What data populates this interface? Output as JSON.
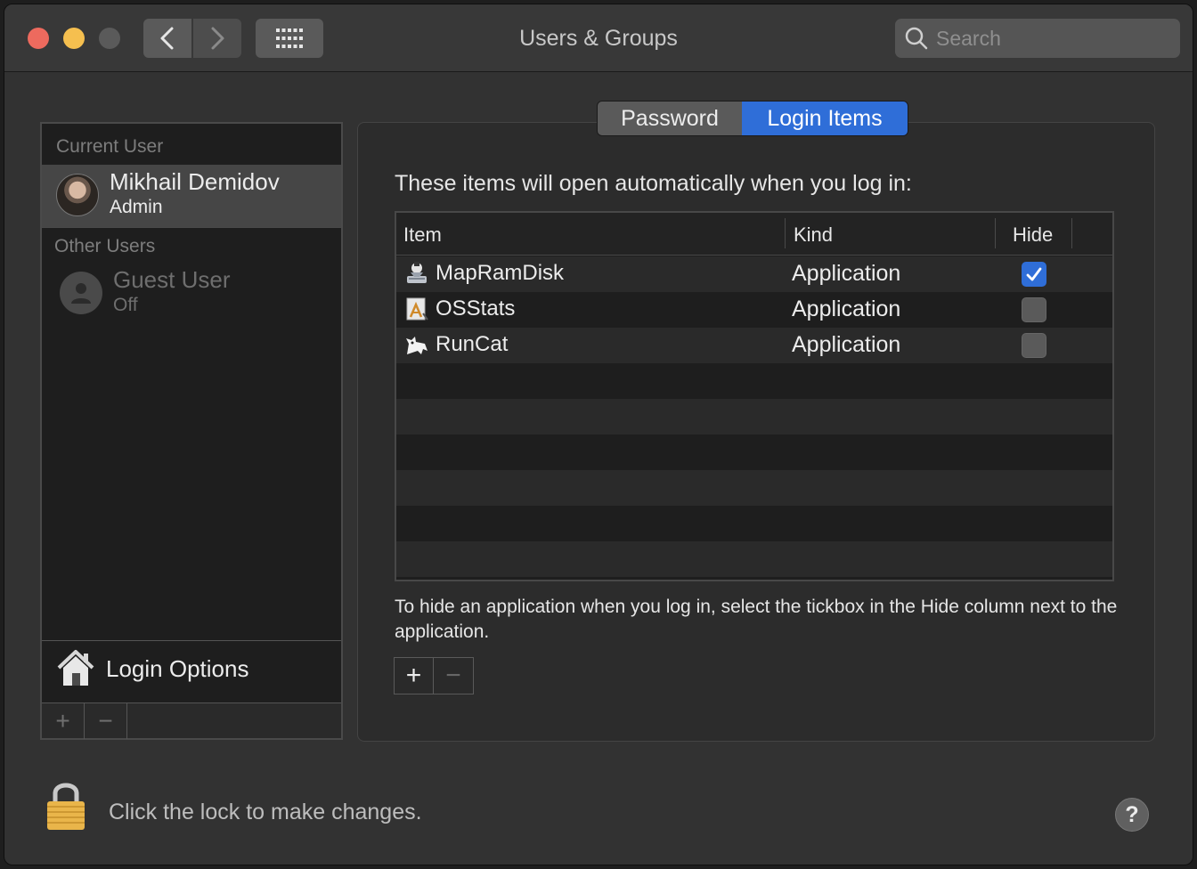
{
  "window": {
    "title": "Users & Groups",
    "search_placeholder": "Search"
  },
  "sidebar": {
    "current_user_label": "Current User",
    "current_user": {
      "name": "Mikhail Demidov",
      "role": "Admin"
    },
    "other_users_label": "Other Users",
    "other_users": [
      {
        "name": "Guest User",
        "status": "Off"
      }
    ],
    "login_options_label": "Login Options",
    "add_label": "+",
    "remove_label": "−"
  },
  "tabs": {
    "password": "Password",
    "login_items": "Login Items",
    "selected": "Login Items"
  },
  "main": {
    "intro": "These items will open automatically when you log in:",
    "columns": {
      "item": "Item",
      "kind": "Kind",
      "hide": "Hide"
    },
    "rows": [
      {
        "name": "MapRamDisk",
        "kind": "Application",
        "hide": true,
        "icon": "mapramdisk-icon"
      },
      {
        "name": "OSStats",
        "kind": "Application",
        "hide": false,
        "icon": "osstats-icon"
      },
      {
        "name": "RunCat",
        "kind": "Application",
        "hide": false,
        "icon": "runcat-icon"
      }
    ],
    "note": "To hide an application when you log in, select the tickbox in the Hide column next to the application.",
    "add_label": "+",
    "remove_label": "−"
  },
  "footer": {
    "lock_text": "Click the lock to make changes.",
    "help_label": "?"
  },
  "colors": {
    "accent": "#2f6ed8",
    "close": "#ed6a5e",
    "minimize": "#f5bf4f"
  }
}
